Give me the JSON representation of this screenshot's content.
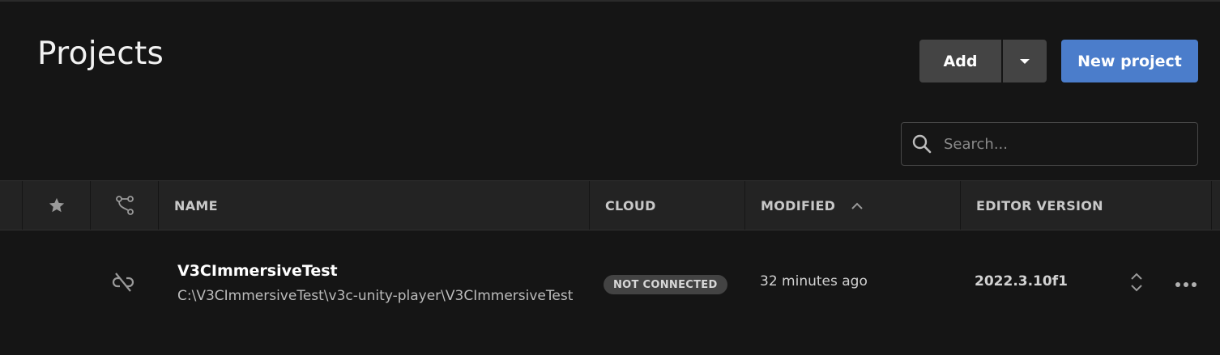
{
  "header": {
    "title": "Projects",
    "add_label": "Add",
    "new_project_label": "New project"
  },
  "search": {
    "placeholder": "Search..."
  },
  "table": {
    "columns": {
      "name": "NAME",
      "cloud": "CLOUD",
      "modified": "MODIFIED",
      "editor_version": "EDITOR VERSION"
    },
    "sort": {
      "column": "modified",
      "direction": "ascending"
    },
    "rows": [
      {
        "name": "V3CImmersiveTest",
        "path": "C:\\V3CImmersiveTest\\v3c-unity-player\\V3CImmersiveTest",
        "cloud_status": "NOT CONNECTED",
        "modified": "32 minutes ago",
        "editor_version": "2022.3.10f1"
      }
    ]
  },
  "colors": {
    "background": "#151515",
    "header_row": "#232323",
    "button_secondary": "#444444",
    "button_primary": "#4b7dcb",
    "badge": "#434343"
  }
}
